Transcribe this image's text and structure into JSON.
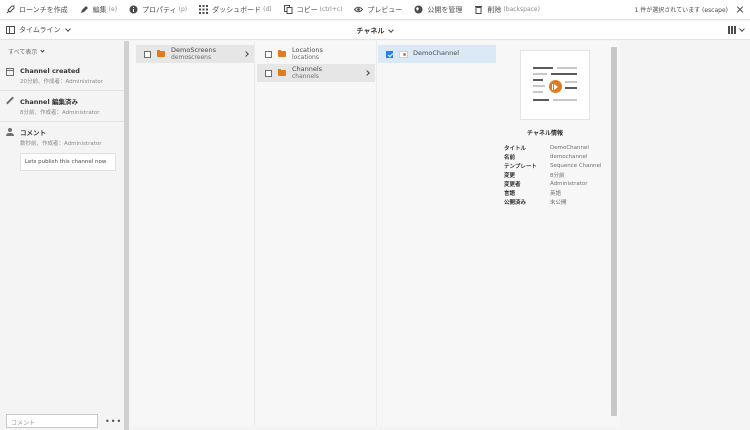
{
  "toolbar": {
    "buttons": [
      {
        "label": "ローンチを作成",
        "shortcut": ""
      },
      {
        "label": "編集",
        "shortcut": "(e)"
      },
      {
        "label": "プロパティ",
        "shortcut": "(p)"
      },
      {
        "label": "ダッシュボード",
        "shortcut": "(d)"
      },
      {
        "label": "コピー",
        "shortcut": "(ctrl+c)"
      },
      {
        "label": "プレビュー",
        "shortcut": ""
      },
      {
        "label": "公開を管理",
        "shortcut": ""
      },
      {
        "label": "削除",
        "shortcut": "(backspace)"
      }
    ],
    "status": "1 件が選択されています (escape)"
  },
  "subbar": {
    "rail_label": "タイムライン",
    "center_title": "チャネル"
  },
  "rail": {
    "filter": "すべて表示",
    "items": [
      {
        "title": "Channel created",
        "meta": "20分前、作成者：Administrator",
        "icon": "calendar-icon"
      },
      {
        "title": "Channel 編集済み",
        "meta": "8分前、作成者：Administrator",
        "icon": "pencil-icon"
      },
      {
        "title": "コメント",
        "meta": "数秒前、作成者：Administrator",
        "icon": "user-icon",
        "comment": "Lets publish this channel now"
      }
    ],
    "comment_placeholder": "コメント",
    "more": "•••"
  },
  "columns": {
    "col1": [
      {
        "title": "DemoScreens",
        "subtitle": "demoscreens"
      }
    ],
    "col2": [
      {
        "title": "Locations",
        "subtitle": "locations"
      },
      {
        "title": "Channels",
        "subtitle": "channels"
      }
    ],
    "col3": [
      {
        "title": "DemoChannel"
      }
    ]
  },
  "info": {
    "heading": "チャネル情報",
    "rows": [
      {
        "k": "タイトル",
        "v": "DemoChannel"
      },
      {
        "k": "名前",
        "v": "demochannel"
      },
      {
        "k": "テンプレート",
        "v": "Sequence Channel"
      },
      {
        "k": "変更",
        "v": "8分前"
      },
      {
        "k": "変更者",
        "v": "Administrator"
      },
      {
        "k": "言語",
        "v": "英語"
      },
      {
        "k": "公開済み",
        "v": "未公開"
      }
    ]
  },
  "colors": {
    "accent": "#2680eb",
    "folder": "#e07b1f",
    "selected_row": "#dbe8f6"
  }
}
